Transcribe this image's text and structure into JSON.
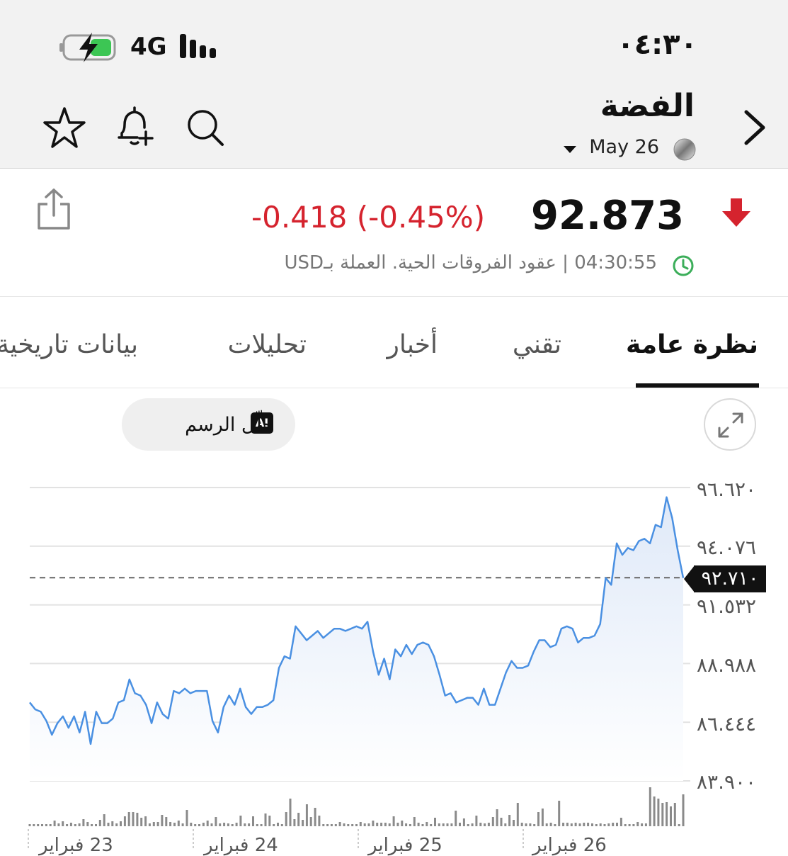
{
  "status_bar": {
    "time": "٠٤:٣٠",
    "network": "4G"
  },
  "header": {
    "title": "الفضة",
    "contract": "May 26"
  },
  "quote": {
    "price": "92.873",
    "change": "-0.418 (-0.45%)",
    "direction": "down",
    "time": "04:30:55",
    "info": "عقود الفروقات الحية. العملة بـUSD",
    "colors": {
      "down": "#d5232e",
      "clock": "#3cae5a"
    }
  },
  "tabs": [
    {
      "label": "نظرة عامة",
      "active": true
    },
    {
      "label": "تقني",
      "active": false
    },
    {
      "label": "أخبار",
      "active": false
    },
    {
      "label": "تحليلات",
      "active": false
    },
    {
      "label": "بيانات تاريخية",
      "active": false
    }
  ],
  "ai_button": {
    "badge": "AI",
    "label": "حلّل الرسم"
  },
  "chart_data": {
    "type": "line",
    "ylim": [
      83.9,
      96.62
    ],
    "y_ticks": [
      "٩٦.٦٢٠",
      "٩٤.٠٧٦",
      "٩١.٥٣٢",
      "٨٨.٩٨٨",
      "٨٦.٤٤٤",
      "٨٣.٩٠٠"
    ],
    "y_tick_values": [
      96.62,
      94.076,
      91.532,
      88.988,
      86.444,
      83.9
    ],
    "current_price": 92.71,
    "current_price_label": "٩٢.٧١٠",
    "x_labels": [
      "23 فبراير",
      "24 فبراير",
      "25 فبراير",
      "26 فبراير"
    ],
    "line_color": "#4a90e2",
    "series": [
      {
        "values": [
          87.3,
          87.0,
          86.9,
          86.5,
          85.9,
          86.4,
          86.7,
          86.2,
          86.7,
          86.0,
          86.9,
          85.5,
          86.9,
          86.4,
          86.4,
          86.6,
          87.3,
          87.4,
          88.3,
          87.7,
          87.6,
          87.2,
          86.4,
          87.3,
          86.8,
          86.6,
          87.8,
          87.7,
          87.9,
          87.7,
          87.8,
          87.8,
          87.8,
          86.5,
          86.0,
          87.1,
          87.6,
          87.2,
          87.9,
          87.1,
          86.8,
          87.1,
          87.1,
          87.2,
          87.4,
          88.8,
          89.3,
          89.2,
          90.6,
          90.3,
          90.0,
          90.2,
          90.4,
          90.1,
          90.3,
          90.5,
          90.5,
          90.4,
          90.5,
          90.6,
          90.5,
          90.8,
          89.5,
          88.5,
          89.2,
          88.3,
          89.6,
          89.3,
          89.8,
          89.4,
          89.8,
          89.9,
          89.8,
          89.3,
          88.5,
          87.6,
          87.7,
          87.3,
          87.4,
          87.5,
          87.5,
          87.2,
          87.9,
          87.2,
          87.2,
          87.9,
          88.6,
          89.1,
          88.8,
          88.8,
          88.9,
          89.5,
          90.0,
          90.0,
          89.7,
          89.8,
          90.5,
          90.6,
          90.5,
          89.9,
          90.1,
          90.1,
          90.2,
          90.7,
          92.7,
          92.4,
          94.2,
          93.7,
          94.0,
          93.9,
          94.3,
          94.4,
          94.2,
          95.0,
          94.9,
          96.2,
          95.3,
          93.9,
          92.7
        ]
      }
    ],
    "volume": [
      0.3,
      0.3,
      0.3,
      0.3,
      0.3,
      0.3,
      0.8,
      0.4,
      0.7,
      0.3,
      0.5,
      0.3,
      0.4,
      1.0,
      0.6,
      0.3,
      0.3,
      0.9,
      1.7,
      0.5,
      0.7,
      0.4,
      0.7,
      1.4,
      2.0,
      2.0,
      1.9,
      1.2,
      1.4,
      0.4,
      0.6,
      0.6,
      1.6,
      1.3,
      0.6,
      0.5,
      0.8,
      0.4,
      2.3,
      0.5,
      0.3,
      0.3,
      0.5,
      0.8,
      0.4,
      1.3,
      0.4,
      0.5,
      0.4,
      0.3,
      0.5,
      1.5,
      0.4,
      0.4,
      1.4,
      0.3,
      0.3,
      1.8,
      1.5,
      0.3,
      0.5,
      0.3,
      2.0,
      3.9,
      1.0,
      1.9,
      0.9,
      3.1,
      1.3,
      2.6,
      1.5,
      0.3,
      0.3,
      0.3,
      0.3,
      0.6,
      0.4,
      0.3,
      0.3,
      0.3,
      0.6,
      0.4,
      0.4,
      0.8,
      0.5,
      0.5,
      0.5,
      0.4,
      1.4,
      0.5,
      0.8,
      0.4,
      0.3,
      1.3,
      0.5,
      0.3,
      0.6,
      0.3,
      1.2,
      0.4,
      0.4,
      0.4,
      0.4,
      2.2,
      0.5,
      1.1,
      0.3,
      0.4,
      1.5,
      0.5,
      0.4,
      0.5,
      1.3,
      2.4,
      1.2,
      0.4,
      1.6,
      0.9,
      3.3,
      0.5,
      0.4,
      0.4,
      0.3,
      2.0,
      2.5,
      0.4,
      0.5,
      0.3,
      3.6,
      0.5,
      0.5,
      0.4,
      0.5,
      0.4,
      0.5,
      0.5,
      0.4,
      0.3,
      0.4,
      0.3,
      0.4,
      0.5,
      0.5,
      1.2,
      0.3,
      0.3,
      0.3,
      0.6,
      0.4,
      0.4,
      5.5,
      4.2,
      3.9,
      3.3,
      3.4,
      2.8,
      3.3,
      0.3,
      4.5
    ]
  }
}
